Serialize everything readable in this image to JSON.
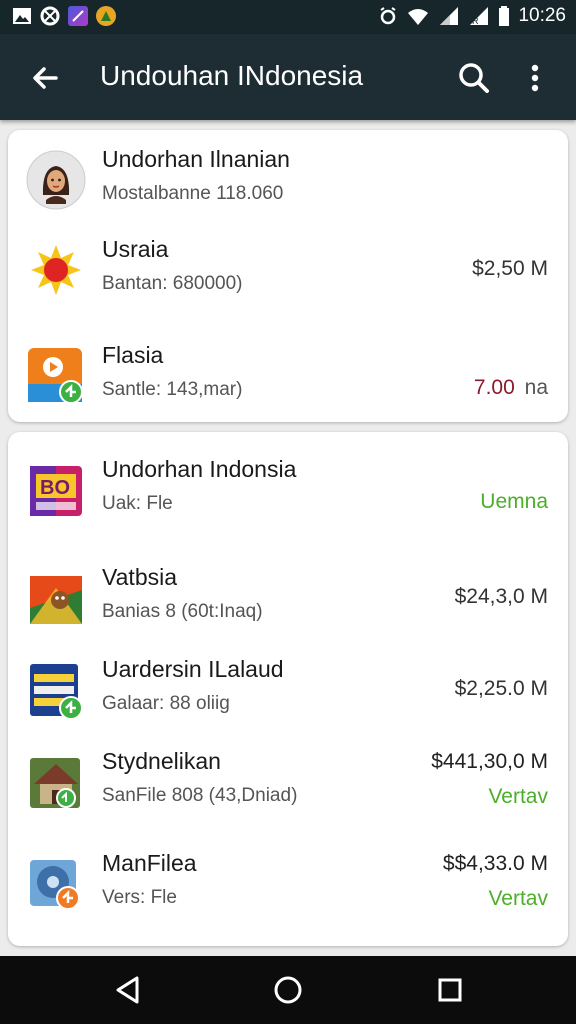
{
  "status_bar": {
    "time": "10:26",
    "left_icons": [
      "image-icon",
      "cat-icon",
      "edit-icon",
      "shield-icon"
    ],
    "right_icons": [
      "alarm-icon",
      "wifi-icon",
      "signal-icon",
      "signal-r-icon",
      "battery-icon"
    ]
  },
  "app_bar": {
    "title": "Undouhan INdonesia"
  },
  "section1": {
    "items": [
      {
        "name": "Undorhan Ilnanian",
        "subtitle": "Mostalbanne 118.060",
        "icon": "avatar-icon"
      },
      {
        "name": "Usraia",
        "subtitle": "Bantan: 680000)",
        "price": "$2,50  M",
        "icon": "sun-icon"
      },
      {
        "name": "Flasia",
        "subtitle": "Santle: 143,mar)",
        "price_value": "7.00",
        "price_unit": "na",
        "icon": "media-app-icon"
      }
    ]
  },
  "section2": {
    "items": [
      {
        "name": "Undorhan Indonsia",
        "subtitle": "Uak: Fle",
        "status": "Uemna",
        "icon": "bo-app-icon"
      },
      {
        "name": "Vatbsia",
        "subtitle": "Banias 8 (60t:Inaq)",
        "price": "$24,3,0  M",
        "icon": "game-app-icon"
      },
      {
        "name": "Uardersin ILalaud",
        "subtitle": "Galaar: 88 oliig",
        "price": "$2,25.0  M",
        "icon": "blue-app-icon"
      },
      {
        "name": "Stydnelikan",
        "subtitle": "SanFile 808 (43,Dniad)",
        "price": "$441,30,0 M",
        "status": "Vertav",
        "icon": "house-app-icon"
      },
      {
        "name": "ManFilea",
        "subtitle": "Vers: Fle",
        "price": "$$4,33.0 M",
        "status": "Vertav",
        "icon": "disc-app-icon"
      }
    ]
  },
  "colors": {
    "status_bar": "#17262b",
    "app_bar": "#1e2d33",
    "green": "#4caf2a",
    "red_price": "#8b1a2e"
  },
  "nav_bar": {
    "icons": [
      "back-triangle-icon",
      "home-circle-icon",
      "recents-square-icon"
    ]
  }
}
